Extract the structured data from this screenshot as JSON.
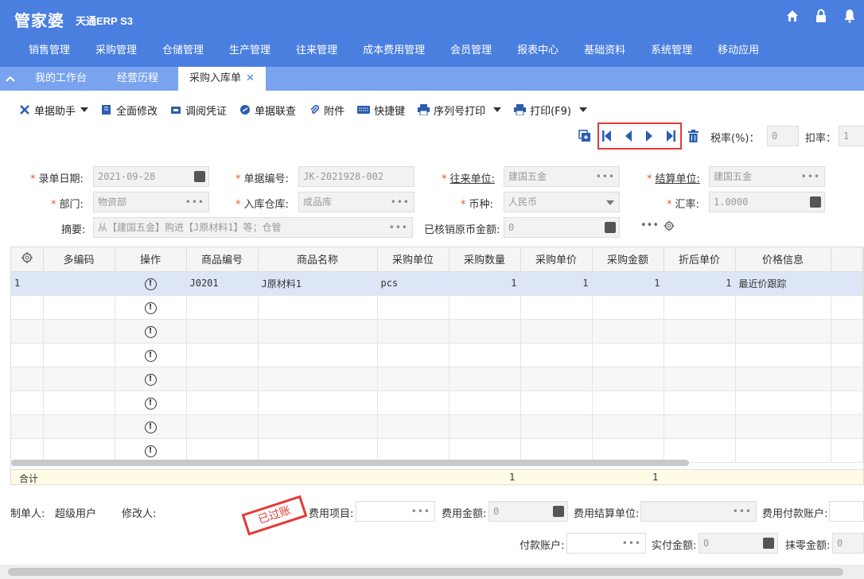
{
  "app": {
    "logo": "管家婆",
    "product": "天通ERP S3"
  },
  "menu": [
    "销售管理",
    "采购管理",
    "仓储管理",
    "生产管理",
    "往来管理",
    "成本费用管理",
    "会员管理",
    "报表中心",
    "基础资料",
    "系统管理",
    "移动应用"
  ],
  "tabs": [
    {
      "label": "我的工作台"
    },
    {
      "label": "经营历程"
    },
    {
      "label": "采购入库单",
      "close": "✕"
    }
  ],
  "toolbar": {
    "assistant": "单据助手",
    "edit_all": "全面修改",
    "voucher": "调阅凭证",
    "link_query": "单据联查",
    "attachment": "附件",
    "shortcut": "快捷键",
    "serial_print": "序列号打印",
    "print": "打印(F9)"
  },
  "nav": {
    "tax_label": "税率(%)：",
    "tax_value": "0",
    "discount_label": "扣率：",
    "discount_value": "1"
  },
  "form": {
    "date_label": "录单日期:",
    "date_value": "2021-09-28",
    "no_label": "单据编号:",
    "no_value": "JK-2021928-002",
    "partner_label": "往来单位:",
    "partner_value": "建国五金",
    "settle_label": "结算单位:",
    "settle_value": "建国五金",
    "dept_label": "部门:",
    "dept_value": "物资部",
    "warehouse_label": "入库仓库:",
    "warehouse_value": "成品库",
    "currency_label": "币种:",
    "currency_value": "人民币",
    "rate_label": "汇率:",
    "rate_value": "1.0000",
    "summary_label": "摘要:",
    "summary_value": "从【建国五金】购进【J原材料1】等；仓管",
    "verified_label": "已核销原币金额:",
    "verified_value": "0"
  },
  "grid": {
    "headers": [
      "多编码",
      "操作",
      "商品编号",
      "商品名称",
      "采购单位",
      "采购数量",
      "采购单价",
      "采购金额",
      "折后单价",
      "价格信息"
    ],
    "row1": {
      "index": "1",
      "code": "J0201",
      "name": "J原材料1",
      "unit": "pcs",
      "qty": "1",
      "price": "1",
      "amount": "1",
      "disc_price": "1",
      "price_info": "最近价跟踪"
    },
    "total_label": "合计",
    "total_qty": "1",
    "total_amount": "1"
  },
  "footer": {
    "creator_label": "制单人:",
    "creator_value": "超级用户",
    "modifier_label": "修改人:",
    "stamp": "已过账",
    "expense_item_label": "费用项目:",
    "expense_amount_label": "费用金额:",
    "expense_amount_value": "0",
    "expense_settle_label": "费用结算单位:",
    "expense_account_label": "费用付款账户:",
    "pay_account_label": "付款账户:",
    "paid_label": "实付金额:",
    "paid_value": "0",
    "rounding_label": "抹零金额:",
    "rounding_value": "0"
  }
}
